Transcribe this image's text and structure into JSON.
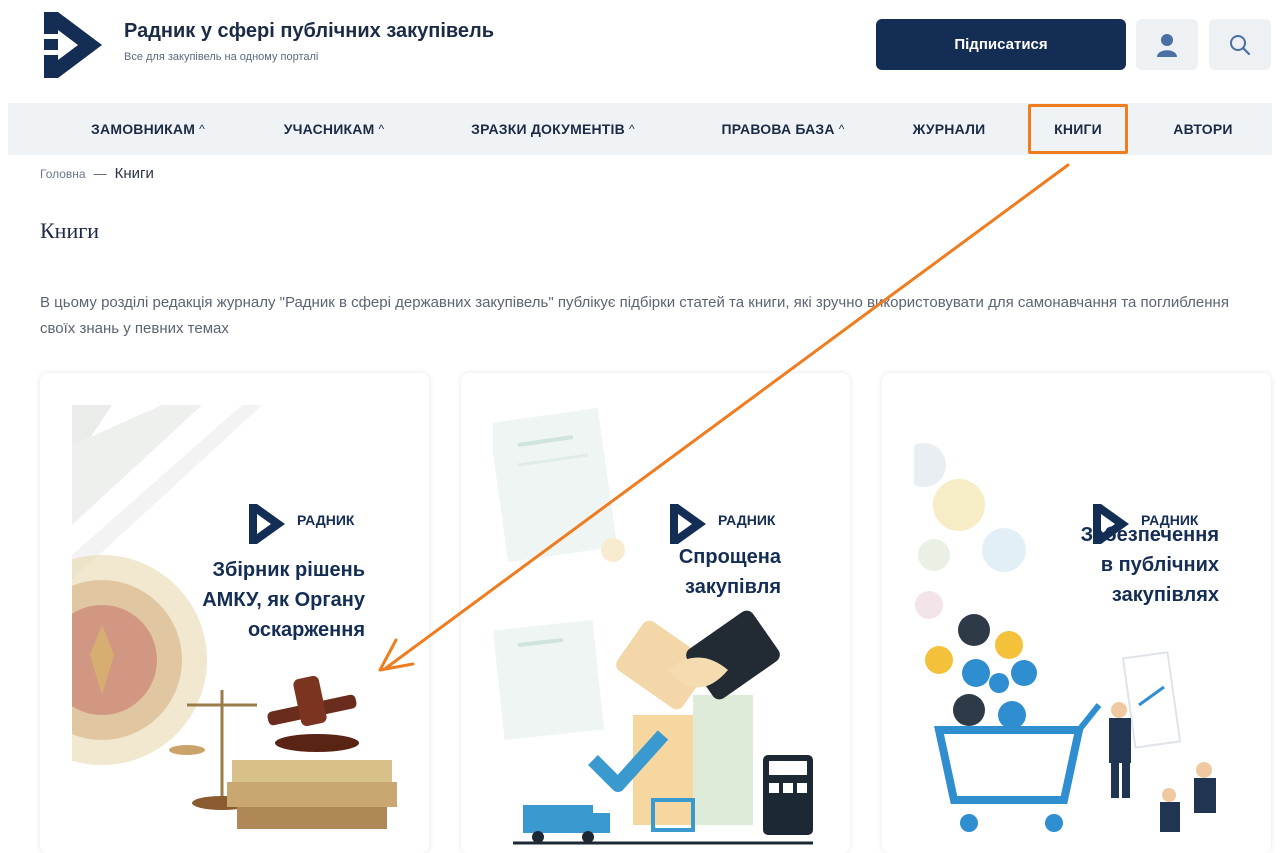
{
  "header": {
    "title": "Радник у сфері публічних закупівель",
    "subtitle": "Все для закупівель на одному порталі",
    "subscribe_label": "Підписатися",
    "user_icon": "user-icon",
    "search_icon": "search-icon"
  },
  "nav": {
    "items": [
      {
        "label": "ЗАМОВНИКАМ",
        "caret": "^"
      },
      {
        "label": "УЧАСНИКАМ",
        "caret": "^"
      },
      {
        "label": "ЗРАЗКИ ДОКУМЕНТІВ",
        "caret": "^"
      },
      {
        "label": "ПРАВОВА БАЗА",
        "caret": "^"
      },
      {
        "label": "ЖУРНАЛИ"
      },
      {
        "label": "КНИГИ",
        "active": true
      },
      {
        "label": "АВТОРИ"
      }
    ]
  },
  "breadcrumb": {
    "home": "Головна",
    "separator": "—",
    "current": "Книги"
  },
  "page": {
    "title": "Книги",
    "intro": "В цьому розділі редакція журналу \"Радник в сфері державних закупівель\" публікує підбірки статей та книги, які зручно використовувати для самонавчання та поглиблення своїх знань у певних темах"
  },
  "books": [
    {
      "logo_text": "РАДНИК",
      "title_lines": [
        "Збірник рішень",
        "АМКУ, як Органу",
        "оскарження"
      ],
      "illustration": "gavel-scales-books-illustration"
    },
    {
      "logo_text": "РАДНИК",
      "title_lines": [
        "Спрощена",
        "закупівля"
      ],
      "illustration": "handshake-delivery-illustration"
    },
    {
      "logo_text": "РАДНИК",
      "title_lines": [
        "Забезпечення",
        "в публічних",
        "закупівлях"
      ],
      "illustration": "shopping-cart-presentation-illustration"
    }
  ],
  "colors": {
    "brand_navy": "#142d55",
    "accent_orange": "#f07c20",
    "nav_bg": "#f0f3f5",
    "text_muted": "#5b6473"
  }
}
